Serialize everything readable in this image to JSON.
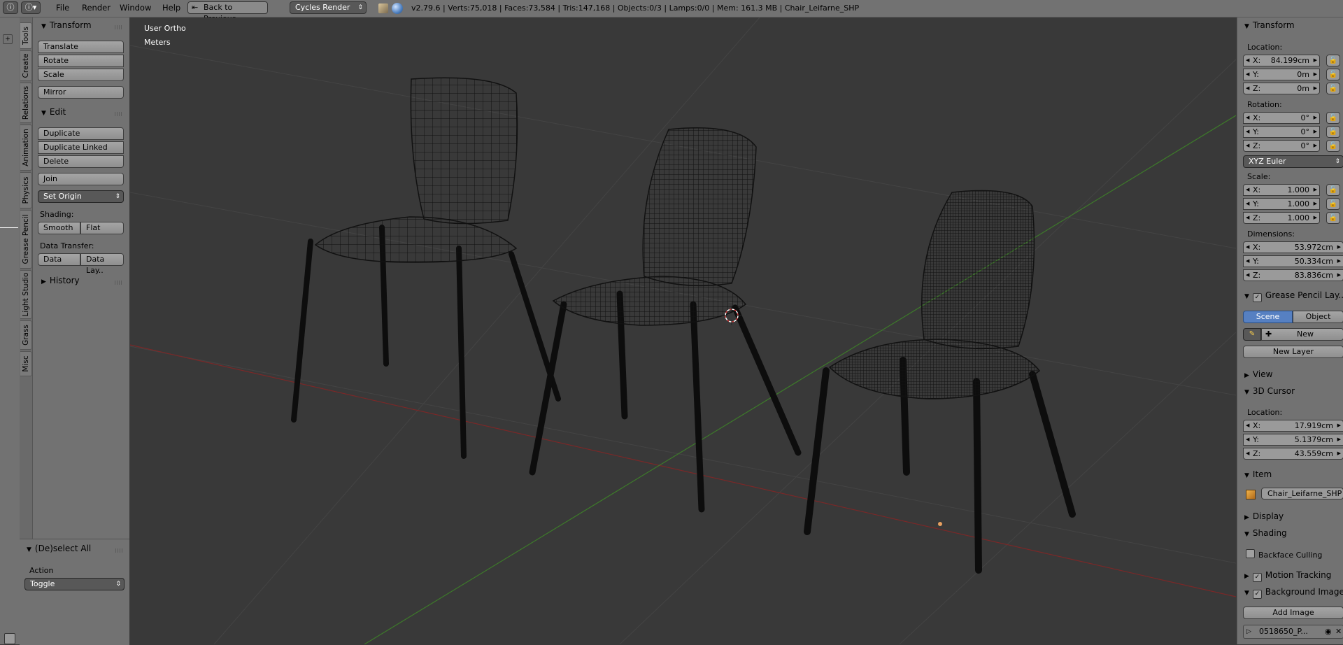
{
  "header": {
    "menus": [
      "File",
      "Render",
      "Window",
      "Help"
    ],
    "back_button": "Back to Previous",
    "render_engine": "Cycles Render",
    "stats": "v2.79.6 | Verts:75,018 | Faces:73,584 | Tris:147,168 | Objects:0/3 | Lamps:0/0 | Mem: 161.3 MB | Chair_Leifarne_SHP"
  },
  "tabs": [
    "Tools",
    "Create",
    "Relations",
    "Animation",
    "Physics",
    "Grease Pencil",
    "Light Studio",
    "Grass",
    "Misc"
  ],
  "tool_shelf": {
    "transform_title": "Transform",
    "translate": "Translate",
    "rotate": "Rotate",
    "scale": "Scale",
    "mirror": "Mirror",
    "edit_title": "Edit",
    "duplicate": "Duplicate",
    "duplicate_linked": "Duplicate Linked",
    "delete": "Delete",
    "join": "Join",
    "set_origin": "Set Origin",
    "shading_label": "Shading:",
    "smooth": "Smooth",
    "flat": "Flat",
    "data_transfer_label": "Data Transfer:",
    "data": "Data",
    "data_layers": "Data Lay..",
    "history_title": "History"
  },
  "operator": {
    "title": "(De)select All",
    "action_label": "Action",
    "action_value": "Toggle"
  },
  "viewport": {
    "view_name": "User Ortho",
    "units": "Meters"
  },
  "properties": {
    "transform_title": "Transform",
    "location_label": "Location:",
    "location": [
      {
        "k": "X:",
        "v": "84.199cm"
      },
      {
        "k": "Y:",
        "v": "0m"
      },
      {
        "k": "Z:",
        "v": "0m"
      }
    ],
    "rotation_label": "Rotation:",
    "rotation": [
      {
        "k": "X:",
        "v": "0°"
      },
      {
        "k": "Y:",
        "v": "0°"
      },
      {
        "k": "Z:",
        "v": "0°"
      }
    ],
    "rotation_mode": "XYZ Euler",
    "scale_label": "Scale:",
    "scale": [
      {
        "k": "X:",
        "v": "1.000"
      },
      {
        "k": "Y:",
        "v": "1.000"
      },
      {
        "k": "Z:",
        "v": "1.000"
      }
    ],
    "dimensions_label": "Dimensions:",
    "dimensions": [
      {
        "k": "X:",
        "v": "53.972cm"
      },
      {
        "k": "Y:",
        "v": "50.334cm"
      },
      {
        "k": "Z:",
        "v": "83.836cm"
      }
    ],
    "grease_pencil_title": "Grease Pencil Lay...",
    "scene_tab": "Scene",
    "object_tab": "Object",
    "new_button": "New",
    "new_layer_button": "New Layer",
    "view_title": "View",
    "cursor_title": "3D Cursor",
    "cursor_location_label": "Location:",
    "cursor_location": [
      {
        "k": "X:",
        "v": "17.919cm"
      },
      {
        "k": "Y:",
        "v": "5.1379cm"
      },
      {
        "k": "Z:",
        "v": "43.559cm"
      }
    ],
    "item_title": "Item",
    "item_name": "Chair_Leifarne_SHP",
    "display_title": "Display",
    "shading_title": "Shading",
    "backface_culling": "Backface Culling",
    "motion_tracking": "Motion Tracking",
    "background_images": "Background Images",
    "add_image": "Add Image",
    "image_name": "0518650_P..."
  },
  "colors": {
    "ui_gray": "#727272",
    "viewport_bg": "#393939",
    "accent_blue": "#5680c2",
    "x_axis_red": "#7a2828",
    "y_axis_green": "#3d7a2a"
  }
}
